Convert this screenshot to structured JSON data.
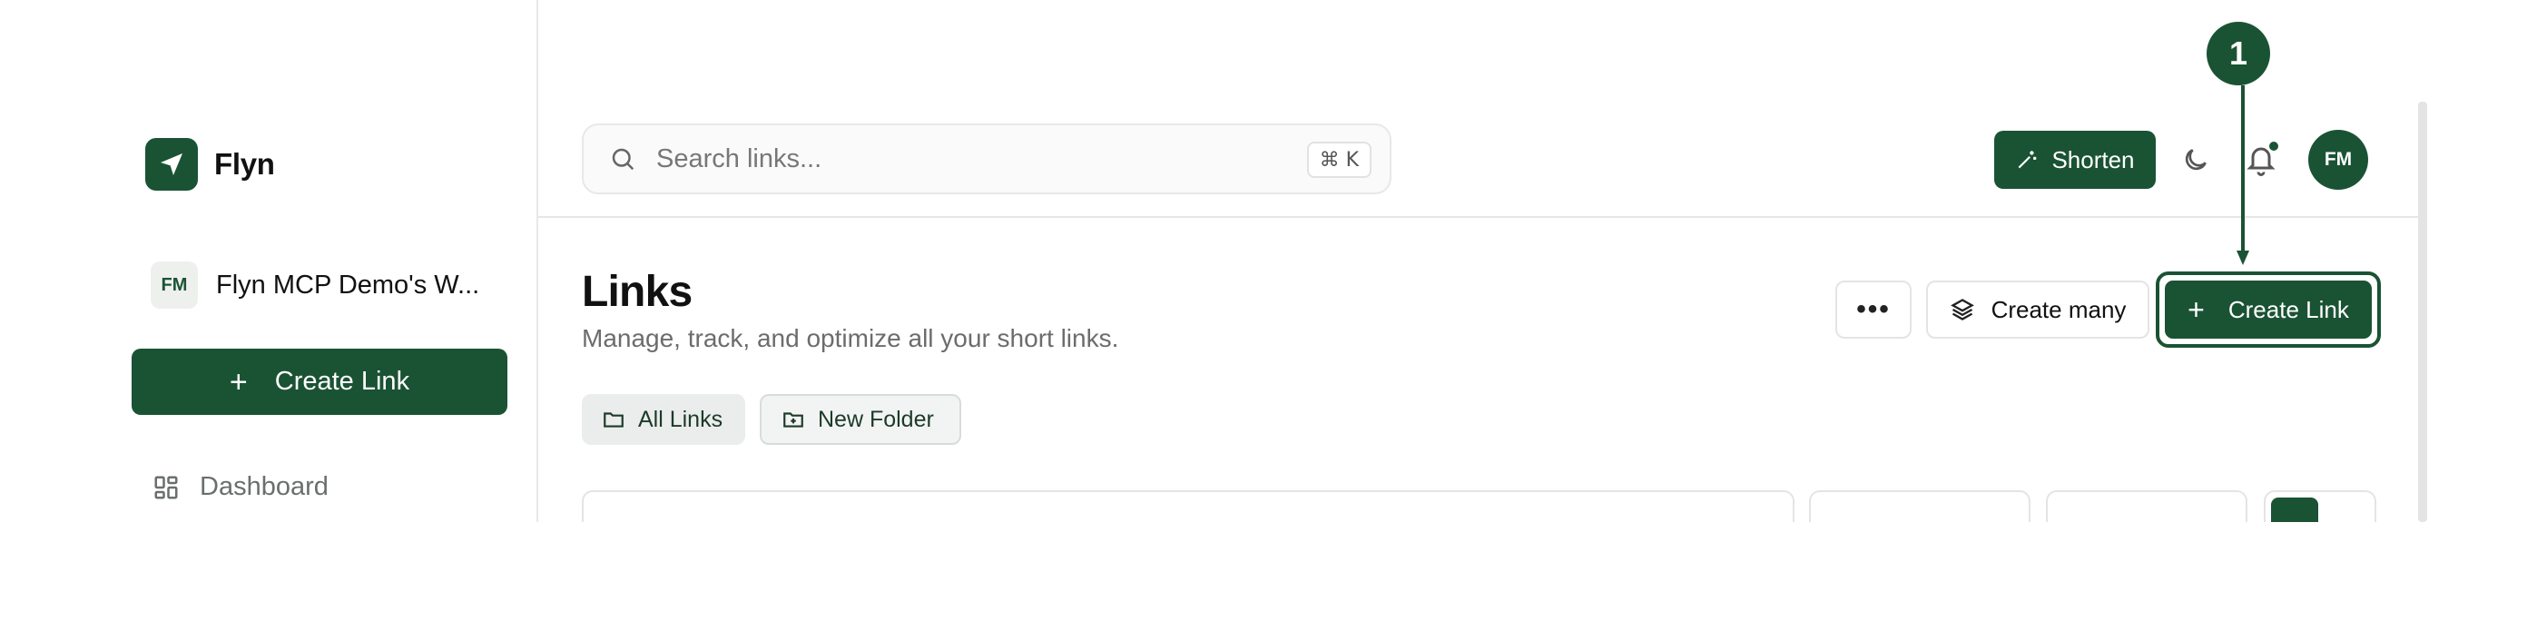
{
  "sidebar": {
    "brand_name": "Flyn",
    "workspace": {
      "badge": "FM",
      "name": "Flyn MCP Demo's W..."
    },
    "create_button": "Create Link",
    "nav": [
      {
        "label": "Dashboard",
        "icon": "dashboard-grid-icon"
      }
    ]
  },
  "topbar": {
    "search_placeholder": "Search links...",
    "shortcut": "⌘ K",
    "shorten_label": "Shorten",
    "avatar_initials": "FM"
  },
  "main": {
    "title": "Links",
    "subtitle": "Manage, track, and optimize all your short links.",
    "more_label": "•••",
    "create_many_label": "Create many",
    "create_link_label": "Create Link",
    "chips": {
      "all_links": "All Links",
      "new_folder": "New Folder"
    }
  },
  "annotation": {
    "marker": "1"
  },
  "colors": {
    "accent": "#1a5334",
    "border": "#e4e4e4",
    "muted_text": "#6c6c6c"
  }
}
